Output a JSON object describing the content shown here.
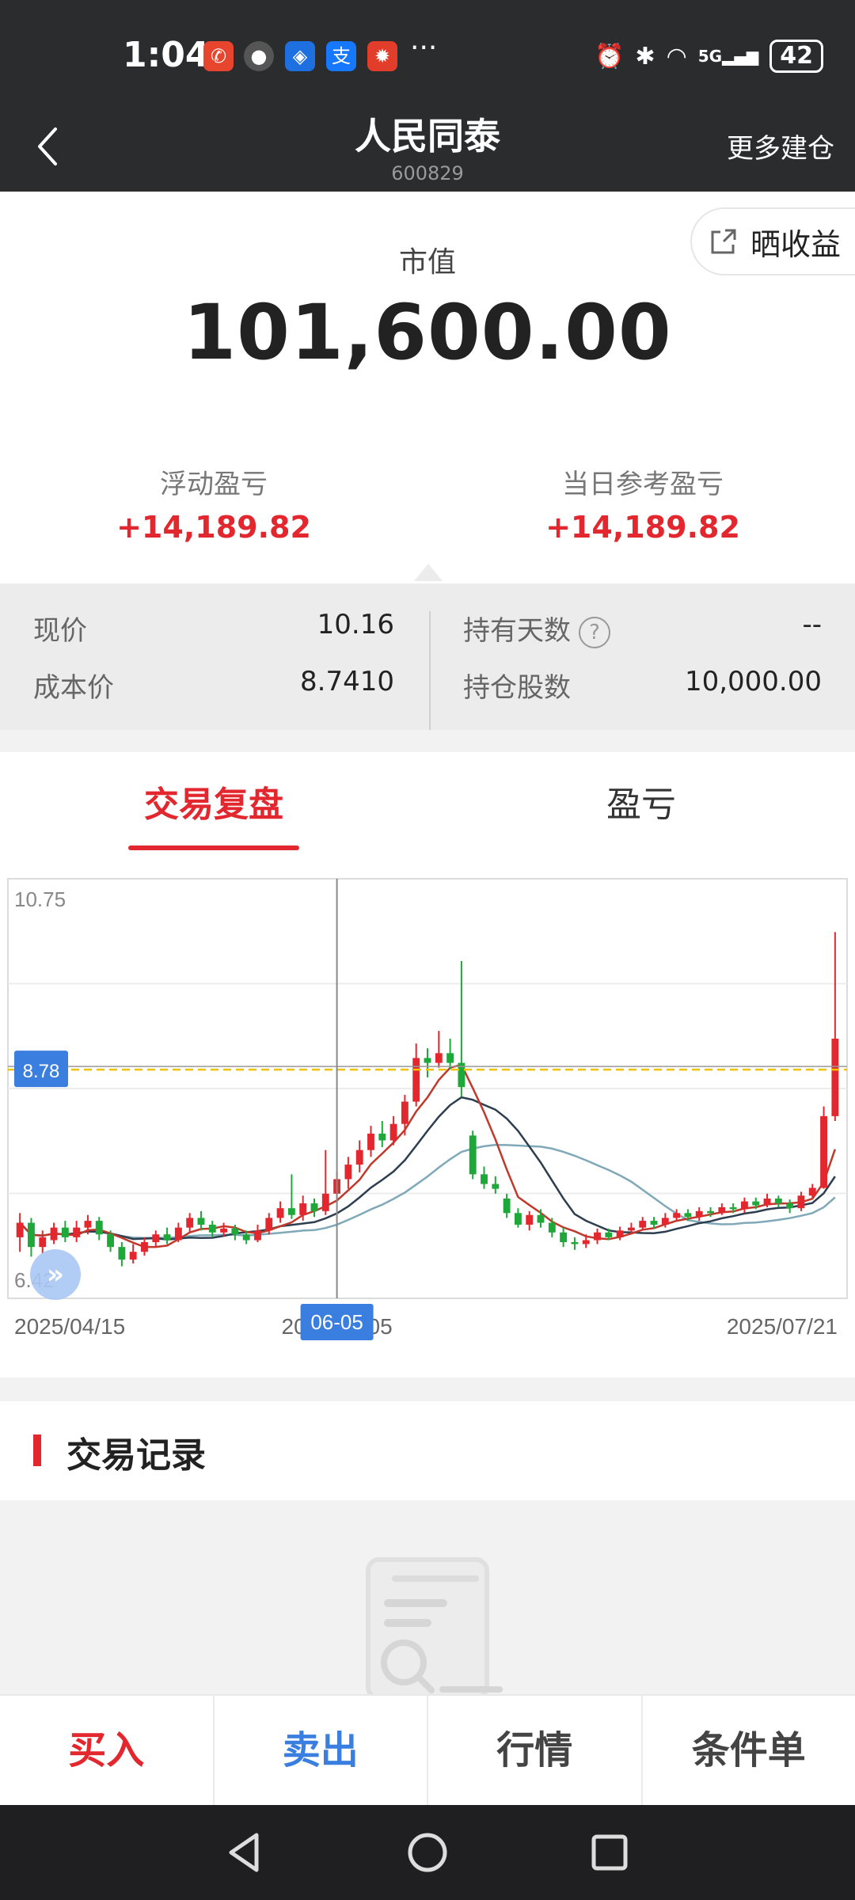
{
  "status_bar": {
    "time": "1:04",
    "battery": "42",
    "signal": "5G"
  },
  "header": {
    "title": "人民同泰",
    "code": "600829",
    "right_action": "更多建仓"
  },
  "summary": {
    "share_label": "晒收益",
    "market_value_label": "市值",
    "market_value": "101,600.00",
    "floating_pl_label": "浮动盈亏",
    "floating_pl": "+14,189.82",
    "daily_pl_label": "当日参考盈亏",
    "daily_pl": "+14,189.82"
  },
  "position": {
    "current_price_label": "现价",
    "current_price": "10.16",
    "cost_price_label": "成本价",
    "cost_price": "8.7410",
    "holding_days_label": "持有天数",
    "holding_days": "--",
    "shares_label": "持仓股数",
    "shares": "10,000.00"
  },
  "tabs": [
    {
      "label": "交易复盘"
    },
    {
      "label": "盈亏"
    }
  ],
  "chart_data": {
    "type": "candlestick",
    "y_top_label": "10.75",
    "y_bottom_label": "6.42",
    "ylim": [
      6.42,
      10.75
    ],
    "cost_line": 8.78,
    "cost_line_label": "8.78",
    "x_start_label": "2025/04/15",
    "x_mid_label": "2025/06/05",
    "x_end_label": "2025/07/21",
    "crosshair_label": "06-05",
    "crosshair_index": 28,
    "colors": {
      "up": "#e2282e",
      "down": "#1ea83a",
      "ma5": "#c0392b",
      "ma10": "#2c3e50",
      "ma20": "#7fa9b8",
      "cost": "#f2c200"
    },
    "candles": [
      [
        7.05,
        7.2,
        7.3,
        6.9
      ],
      [
        7.2,
        6.95,
        7.25,
        6.85
      ],
      [
        6.95,
        7.05,
        7.12,
        6.88
      ],
      [
        7.02,
        7.15,
        7.2,
        6.98
      ],
      [
        7.15,
        7.05,
        7.22,
        7.0
      ],
      [
        7.05,
        7.15,
        7.22,
        7.0
      ],
      [
        7.15,
        7.22,
        7.28,
        7.08
      ],
      [
        7.22,
        7.08,
        7.26,
        7.02
      ],
      [
        7.08,
        6.95,
        7.12,
        6.9
      ],
      [
        6.95,
        6.82,
        7.0,
        6.75
      ],
      [
        6.82,
        6.9,
        6.98,
        6.78
      ],
      [
        6.9,
        7.0,
        7.05,
        6.86
      ],
      [
        7.0,
        7.08,
        7.12,
        6.95
      ],
      [
        7.08,
        7.02,
        7.15,
        6.98
      ],
      [
        7.02,
        7.15,
        7.2,
        7.0
      ],
      [
        7.15,
        7.25,
        7.3,
        7.1
      ],
      [
        7.25,
        7.18,
        7.32,
        7.12
      ],
      [
        7.18,
        7.1,
        7.22,
        7.05
      ],
      [
        7.1,
        7.14,
        7.2,
        7.06
      ],
      [
        7.14,
        7.08,
        7.18,
        7.02
      ],
      [
        7.08,
        7.02,
        7.12,
        6.98
      ],
      [
        7.02,
        7.12,
        7.18,
        7.0
      ],
      [
        7.12,
        7.25,
        7.3,
        7.08
      ],
      [
        7.25,
        7.35,
        7.42,
        7.2
      ],
      [
        7.35,
        7.28,
        7.7,
        7.24
      ],
      [
        7.28,
        7.4,
        7.48,
        7.22
      ],
      [
        7.4,
        7.32,
        7.45,
        7.26
      ],
      [
        7.32,
        7.5,
        7.95,
        7.28
      ],
      [
        7.5,
        7.65,
        7.72,
        7.42
      ],
      [
        7.65,
        7.8,
        7.88,
        7.55
      ],
      [
        7.8,
        7.95,
        8.05,
        7.72
      ],
      [
        7.95,
        8.12,
        8.2,
        7.88
      ],
      [
        8.12,
        8.05,
        8.25,
        7.98
      ],
      [
        8.05,
        8.22,
        8.3,
        8.0
      ],
      [
        8.22,
        8.45,
        8.52,
        8.1
      ],
      [
        8.45,
        8.9,
        9.05,
        8.4
      ],
      [
        8.9,
        8.85,
        9.0,
        8.7
      ],
      [
        8.85,
        8.95,
        9.18,
        8.8
      ],
      [
        8.95,
        8.85,
        9.1,
        8.78
      ],
      [
        8.85,
        8.6,
        9.9,
        8.5
      ],
      [
        8.1,
        7.7,
        8.15,
        7.65
      ],
      [
        7.7,
        7.6,
        7.78,
        7.55
      ],
      [
        7.6,
        7.55,
        7.68,
        7.5
      ],
      [
        7.45,
        7.3,
        7.5,
        7.25
      ],
      [
        7.3,
        7.18,
        7.35,
        7.15
      ],
      [
        7.18,
        7.28,
        7.32,
        7.12
      ],
      [
        7.28,
        7.2,
        7.34,
        7.15
      ],
      [
        7.2,
        7.1,
        7.25,
        7.05
      ],
      [
        7.1,
        7.0,
        7.15,
        6.95
      ],
      [
        7.0,
        6.98,
        7.05,
        6.92
      ],
      [
        6.98,
        7.02,
        7.08,
        6.94
      ],
      [
        7.02,
        7.1,
        7.14,
        6.98
      ],
      [
        7.1,
        7.05,
        7.14,
        7.02
      ],
      [
        7.05,
        7.12,
        7.16,
        7.02
      ],
      [
        7.12,
        7.15,
        7.2,
        7.08
      ],
      [
        7.15,
        7.22,
        7.26,
        7.12
      ],
      [
        7.22,
        7.18,
        7.26,
        7.14
      ],
      [
        7.18,
        7.25,
        7.3,
        7.15
      ],
      [
        7.25,
        7.3,
        7.34,
        7.22
      ],
      [
        7.3,
        7.26,
        7.34,
        7.22
      ],
      [
        7.26,
        7.32,
        7.36,
        7.22
      ],
      [
        7.32,
        7.3,
        7.36,
        7.26
      ],
      [
        7.3,
        7.36,
        7.4,
        7.28
      ],
      [
        7.36,
        7.34,
        7.4,
        7.3
      ],
      [
        7.34,
        7.42,
        7.46,
        7.3
      ],
      [
        7.42,
        7.38,
        7.46,
        7.34
      ],
      [
        7.38,
        7.45,
        7.5,
        7.36
      ],
      [
        7.45,
        7.4,
        7.48,
        7.36
      ],
      [
        7.4,
        7.35,
        7.44,
        7.3
      ],
      [
        7.35,
        7.48,
        7.52,
        7.32
      ],
      [
        7.48,
        7.56,
        7.6,
        7.45
      ],
      [
        7.56,
        8.3,
        8.4,
        7.55
      ],
      [
        8.3,
        9.1,
        10.2,
        8.25
      ]
    ]
  },
  "records": {
    "title": "交易记录"
  },
  "bottom_actions": [
    {
      "label": "买入",
      "color": "#e2282e"
    },
    {
      "label": "卖出",
      "color": "#3a7ee0"
    },
    {
      "label": "行情",
      "color": "#444444"
    },
    {
      "label": "条件单",
      "color": "#444444"
    }
  ]
}
